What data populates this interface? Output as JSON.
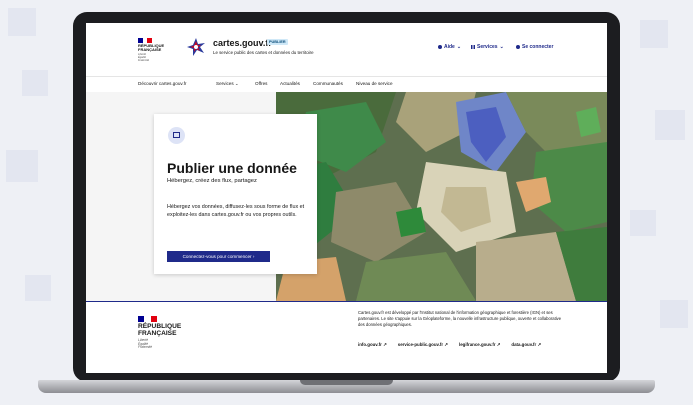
{
  "colors": {
    "accent": "#1f2a8a",
    "flag_blue": "#000091",
    "flag_red": "#e1000f",
    "badge_bg": "#cfe8f7"
  },
  "header": {
    "republic_text": "RÉPUBLIQUE\nFRANÇAISE",
    "republic_motto": "Liberté\nÉgalité\nFraternité",
    "brand_name": "cartes.gouv.fr",
    "badge": "PUBLIER",
    "tagline": "Le service public des cartes et données du territoire",
    "help_label": "Aide",
    "services_label": "Services",
    "login_label": "Se connecter",
    "help_icon": "question-circle-icon",
    "services_icon": "grid-icon",
    "login_icon": "user-icon"
  },
  "nav": {
    "items": [
      "Découvrir cartes.gouv.fr",
      "Services",
      "Offres",
      "Actualités",
      "Communautés",
      "Niveau de service"
    ]
  },
  "hero": {
    "title": "Publier une donnée",
    "subtitle": "Hébergez, créez des flux, partagez",
    "body": "Hébergez vos données, diffusez-les sous forme de flux et exploitez-les dans cartes.gouv.fr ou vos propres outils.",
    "button": "Connectez-vous pour commencer",
    "icon": "database-icon"
  },
  "footer": {
    "republic_text": "RÉPUBLIQUE\nFRANÇAISE",
    "republic_motto": "Liberté\nÉgalité\nFraternité",
    "description": "Cartes.gouv.fr est développé par l'Institut national de l'information géographique et forestière (IGN) et ses partenaires. Le site s'appuie sur la Géoplateforme, la nouvelle infrastructure publique, ouverte et collaborative des données géographiques.",
    "links": [
      "info.gouv.fr",
      "service-public.gouv.fr",
      "legifrance.gouv.fr",
      "data.gouv.fr"
    ]
  }
}
